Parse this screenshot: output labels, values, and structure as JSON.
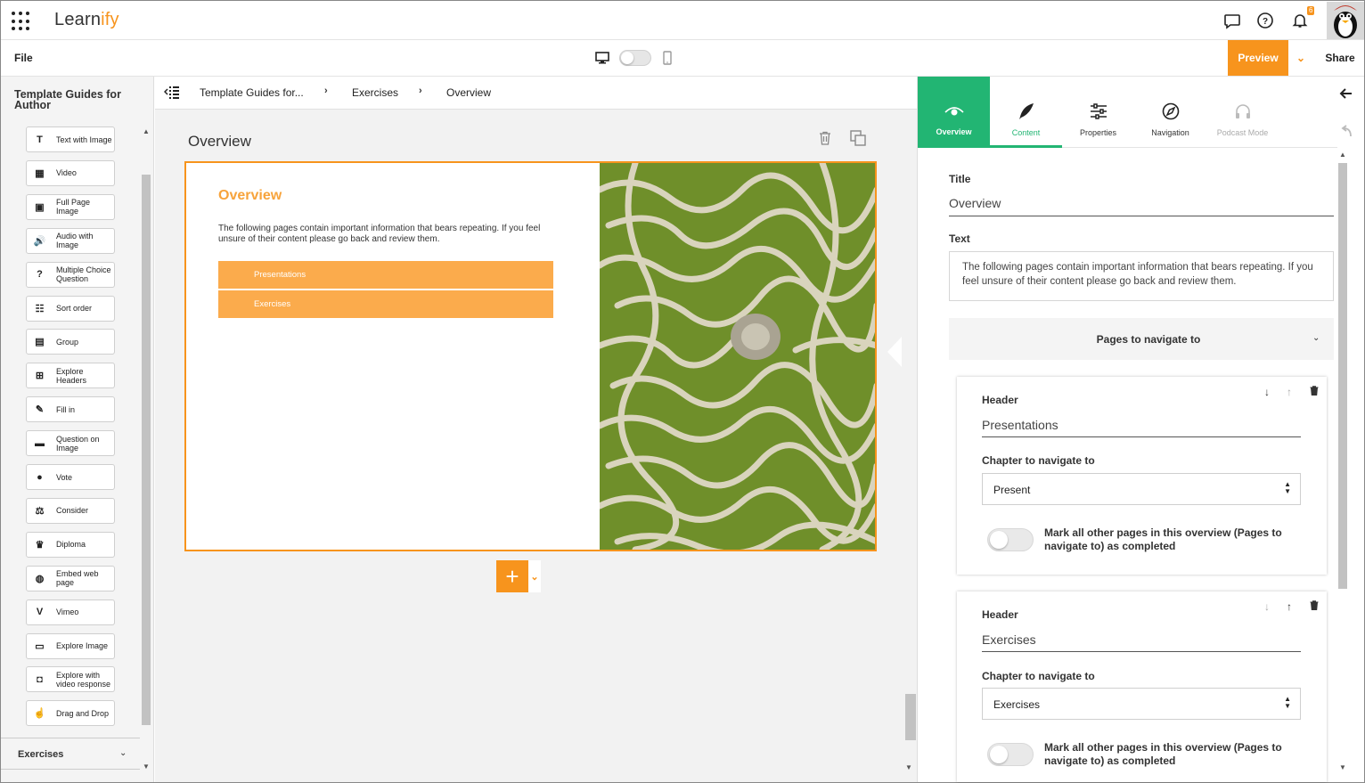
{
  "app": {
    "logo_text": "Learn",
    "logo_accent": "ify",
    "notifications_badge": "6",
    "accent_color": "#f7941d",
    "active_tab_color": "#22b573"
  },
  "toolbar": {
    "file_label": "File",
    "preview_label": "Preview",
    "share_label": "Share"
  },
  "sidebar": {
    "title": "Template Guides for Author",
    "tools": [
      {
        "label": "Text with Image",
        "icon": "text-image-icon",
        "glyph": "T"
      },
      {
        "label": "Video",
        "icon": "video-icon",
        "glyph": "▦"
      },
      {
        "label": "Full Page Image",
        "icon": "image-icon",
        "glyph": "▣"
      },
      {
        "label": "Audio with Image",
        "icon": "audio-icon",
        "glyph": "🔊"
      },
      {
        "label": "Multiple Choice Question",
        "icon": "question-icon",
        "glyph": "?"
      },
      {
        "label": "Sort order",
        "icon": "sort-icon",
        "glyph": "☷"
      },
      {
        "label": "Group",
        "icon": "group-icon",
        "glyph": "▤"
      },
      {
        "label": "Explore Headers",
        "icon": "explore-headers-icon",
        "glyph": "⊞"
      },
      {
        "label": "Fill in",
        "icon": "pencil-icon",
        "glyph": "✎"
      },
      {
        "label": "Question on Image",
        "icon": "speech-icon",
        "glyph": "▬"
      },
      {
        "label": "Vote",
        "icon": "vote-icon",
        "glyph": "●"
      },
      {
        "label": "Consider",
        "icon": "scale-icon",
        "glyph": "⚖"
      },
      {
        "label": "Diploma",
        "icon": "trophy-icon",
        "glyph": "♛"
      },
      {
        "label": "Embed web page",
        "icon": "globe-icon",
        "glyph": "◍"
      },
      {
        "label": "Vimeo",
        "icon": "vimeo-icon",
        "glyph": "V"
      },
      {
        "label": "Explore Image",
        "icon": "explore-image-icon",
        "glyph": "▭"
      },
      {
        "label": "Explore with video response",
        "icon": "video-response-icon",
        "glyph": "◘"
      },
      {
        "label": "Drag and Drop",
        "icon": "drag-icon",
        "glyph": "☝"
      }
    ],
    "exercises_label": "Exercises"
  },
  "breadcrumb": {
    "items": [
      "Template Guides for...",
      "Exercises",
      "Overview"
    ]
  },
  "canvas": {
    "page_title": "Overview",
    "slide": {
      "heading": "Overview",
      "text": "The following pages contain important information that bears repeating. If you feel unsure of their content please go back and review them.",
      "buttons": [
        "Presentations",
        "Exercises"
      ]
    },
    "add_label": "+"
  },
  "rpanel": {
    "tabs": [
      {
        "label": "Overview"
      },
      {
        "label": "Content"
      },
      {
        "label": "Properties"
      },
      {
        "label": "Navigation"
      },
      {
        "label": "Podcast Mode"
      }
    ],
    "title_label": "Title",
    "title_value": "Overview",
    "text_label": "Text",
    "text_value": "The following pages contain important information that bears repeating. If you feel unsure of their content please go back and review them.",
    "pages_nav_label": "Pages to navigate to",
    "cards": [
      {
        "header_label": "Header",
        "header_value": "Presentations",
        "chapter_label": "Chapter to navigate to",
        "chapter_value": "Present",
        "toggle_label": "Mark all other pages in this overview (Pages to navigate to) as completed"
      },
      {
        "header_label": "Header",
        "header_value": "Exercises",
        "chapter_label": "Chapter to navigate to",
        "chapter_value": "Exercises",
        "toggle_label": "Mark all other pages in this overview (Pages to navigate to) as completed"
      }
    ]
  }
}
